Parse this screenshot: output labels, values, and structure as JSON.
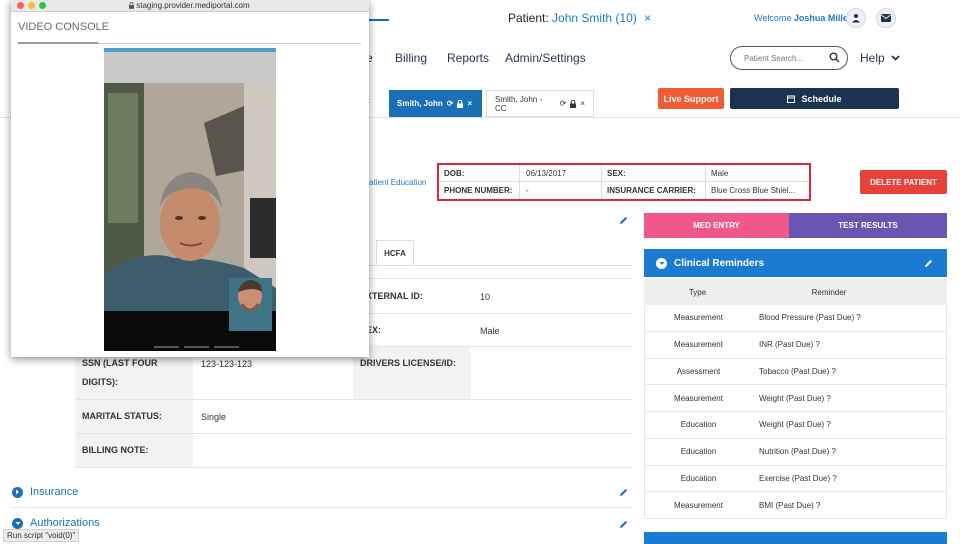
{
  "header": {
    "patient_label": "Patient:",
    "patient_name": "John Smith (10)",
    "welcome_prefix": "Welcome",
    "welcome_user": "Joshua Miller"
  },
  "nav": {
    "partial_item": "e",
    "items": [
      "Billing",
      "Reports",
      "Admin/Settings"
    ],
    "search_placeholder": "Patient Search...",
    "help_label": "Help"
  },
  "tabs": {
    "active_label": "Smith, John",
    "inactive_label": "Smith, John - CC",
    "live_support": "Live Support",
    "schedule": "Schedule"
  },
  "patient_info": {
    "patient_education_link": "atient Education",
    "dob_label": "DOB:",
    "dob": "06/13/2017",
    "sex_label": "SEX:",
    "sex": "Male",
    "phone_label": "PHONE NUMBER:",
    "phone": "-",
    "carrier_label": "INSURANCE CARRIER:",
    "carrier": "Blue Cross Blue Shiel...",
    "delete_button": "DELETE PATIENT"
  },
  "details": {
    "hcfa_tab": "HCFA",
    "external_id_label": "XTERNAL ID:",
    "external_id": "10",
    "sex_label": "EX:",
    "sex": "Male",
    "ssn_label": "SSN (LAST FOUR DIGITS):",
    "ssn": "123-123-123",
    "drivers_label": "DRIVERS LICENSE/ID:",
    "marital_label": "MARITAL STATUS:",
    "marital": "Single",
    "billing_note_label": "BILLING NOTE:"
  },
  "sections": {
    "insurance": "Insurance",
    "authorizations": "Authorizations"
  },
  "clinical": {
    "med_entry": "MED ENTRY",
    "test_results": "TEST RESULTS",
    "reminders_title": "Clinical Reminders",
    "col_type": "Type",
    "col_reminder": "Reminder",
    "rows": [
      {
        "type": "Measurement",
        "reminder": "Blood Pressure  (Past Due) ?"
      },
      {
        "type": "Measurement",
        "reminder": "INR  (Past Due) ?"
      },
      {
        "type": "Assessment",
        "reminder": "Tobacco  (Past Due) ?"
      },
      {
        "type": "Measurement",
        "reminder": "Weight  (Past Due) ?"
      },
      {
        "type": "Education",
        "reminder": "Weight  (Past Due) ?"
      },
      {
        "type": "Education",
        "reminder": "Nutrition  (Past Due) ?"
      },
      {
        "type": "Education",
        "reminder": "Exercise  (Past Due) ?"
      },
      {
        "type": "Measurement",
        "reminder": "BMI  (Past Due) ?"
      }
    ]
  },
  "status_bar": "Run script \"void(0)\"",
  "video_console": {
    "url": "staging.provider.mediportal.com",
    "title": "VIDEO CONSOLE"
  },
  "colors": {
    "primary_blue": "#1a6fb5",
    "live_support": "#f05b33",
    "schedule": "#1c3350",
    "delete": "#e7413a",
    "med_entry": "#f0578a",
    "test_results": "#6a55b3",
    "highlight_border": "#d42a3c"
  },
  "icons": [
    "user-icon",
    "mail-icon",
    "search-icon",
    "chevron-down-icon",
    "refresh-icon",
    "lock-icon",
    "close-icon",
    "calendar-icon",
    "pencil-icon",
    "chevron-circle-icon"
  ]
}
